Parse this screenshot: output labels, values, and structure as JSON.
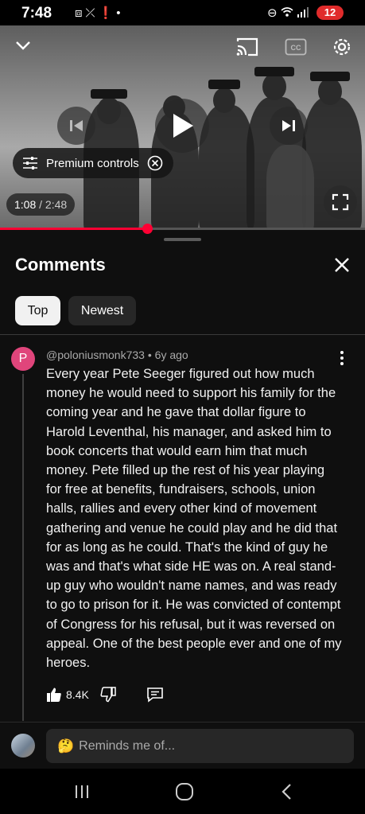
{
  "status_bar": {
    "time": "7:48",
    "battery": "12",
    "left_icons": [
      "screenshot-icon",
      "missed-call-icon",
      "alert-icon",
      "dot-icon"
    ],
    "right_icons": [
      "dnd-icon",
      "wifi-icon",
      "signal-icon",
      "battery-icon"
    ]
  },
  "player": {
    "current_time": "1:08",
    "duration": "2:48",
    "time_separator": " / ",
    "progress": 0.405,
    "premium_label": "Premium controls"
  },
  "comments_panel": {
    "title": "Comments",
    "filters": [
      "Top",
      "Newest"
    ],
    "selected_filter": "Top"
  },
  "comment": {
    "avatar_letter": "P",
    "author": "@poloniusmonk733",
    "separator": " • ",
    "age": "6y ago",
    "text": "Every year Pete Seeger figured out how much money he would need to support his family for the coming year and he gave that dollar figure to Harold Leventhal, his manager, and asked him to book concerts that would earn him that much money. Pete filled up the rest of his year playing for free at benefits, fundraisers, schools, union halls, rallies and every other kind of movement gathering and venue he could play and he did that for as long as he could. That's the kind of guy he was and that's what side HE was on. A real stand-up guy who wouldn't name names, and was ready to go to prison for it. He was convicted of contempt of Congress for his refusal, but it was reversed on appeal. One of the best people ever and one of my heroes.",
    "likes": "8.4K"
  },
  "reply": {
    "emoji": "🤔",
    "placeholder": "Reminds me of..."
  }
}
